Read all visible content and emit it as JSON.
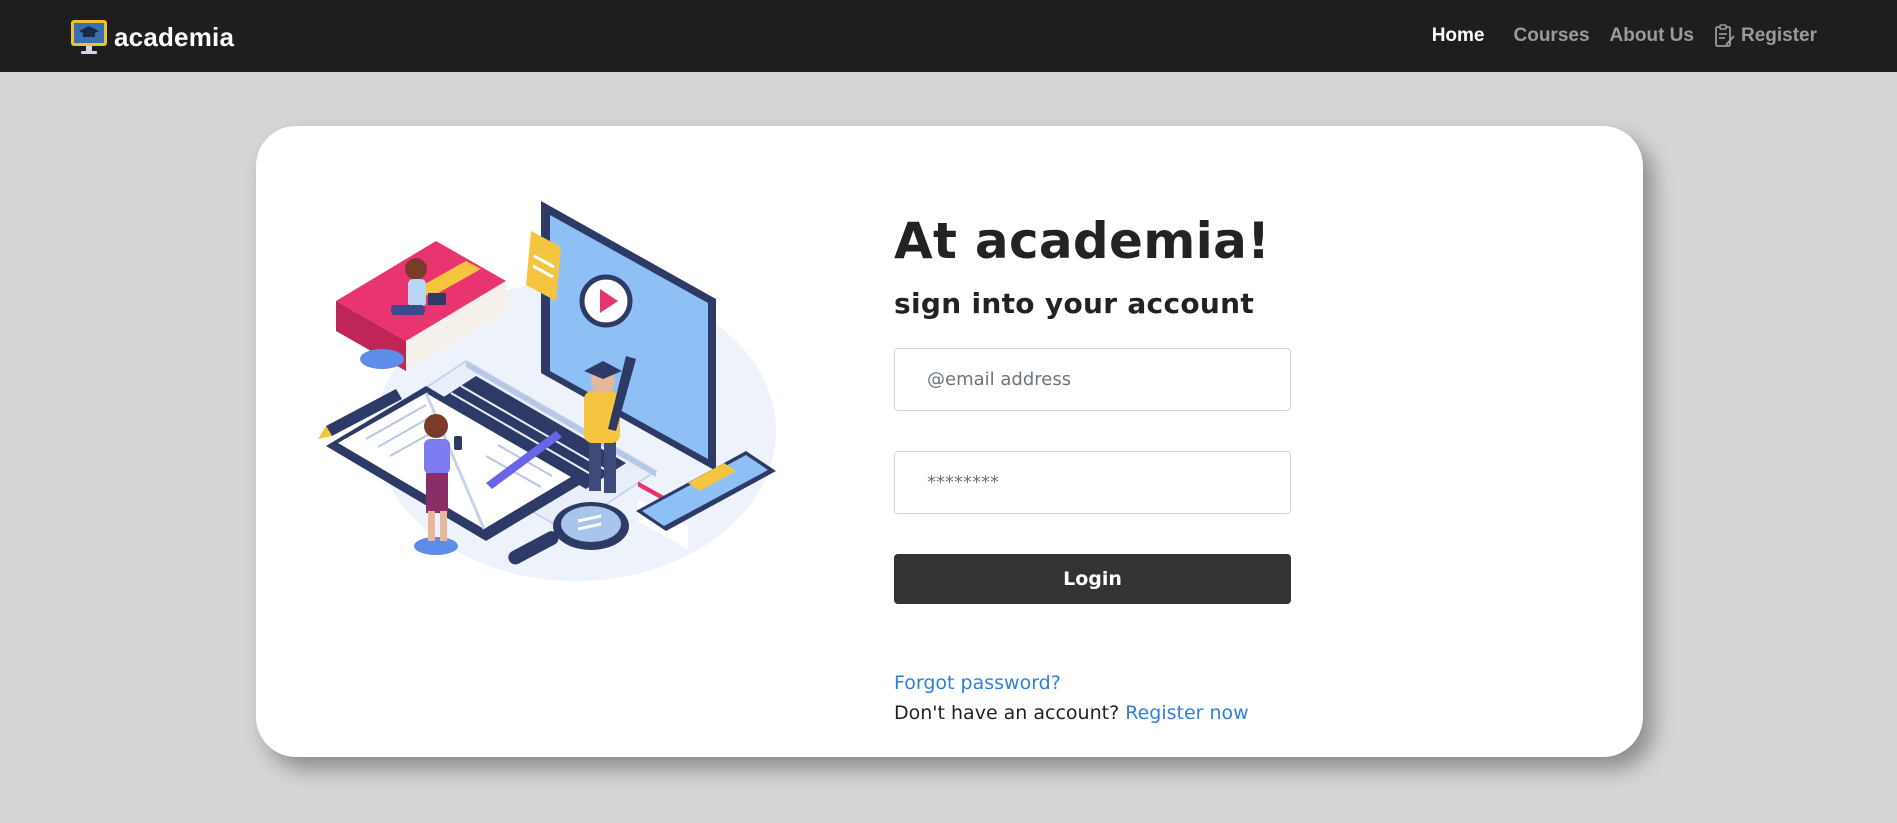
{
  "navbar": {
    "brand": "academia",
    "links": [
      {
        "label": "Home",
        "active": true
      },
      {
        "label": "Courses"
      },
      {
        "label": "About Us"
      },
      {
        "label": "Register",
        "icon": "clipboard-icon"
      }
    ]
  },
  "login": {
    "heading": "At academia!",
    "subheading": "sign into your account",
    "email_placeholder": "@email address",
    "password_placeholder": "********",
    "login_label": "Login",
    "forgot_password": "Forgot password?",
    "no_account_text": "Don't have an account?",
    "register_now": "Register now"
  },
  "colors": {
    "navbar_bg": "#1e1e1e",
    "page_bg": "#d6d6d6",
    "button_bg": "#333333",
    "link": "#2f7fe0"
  }
}
